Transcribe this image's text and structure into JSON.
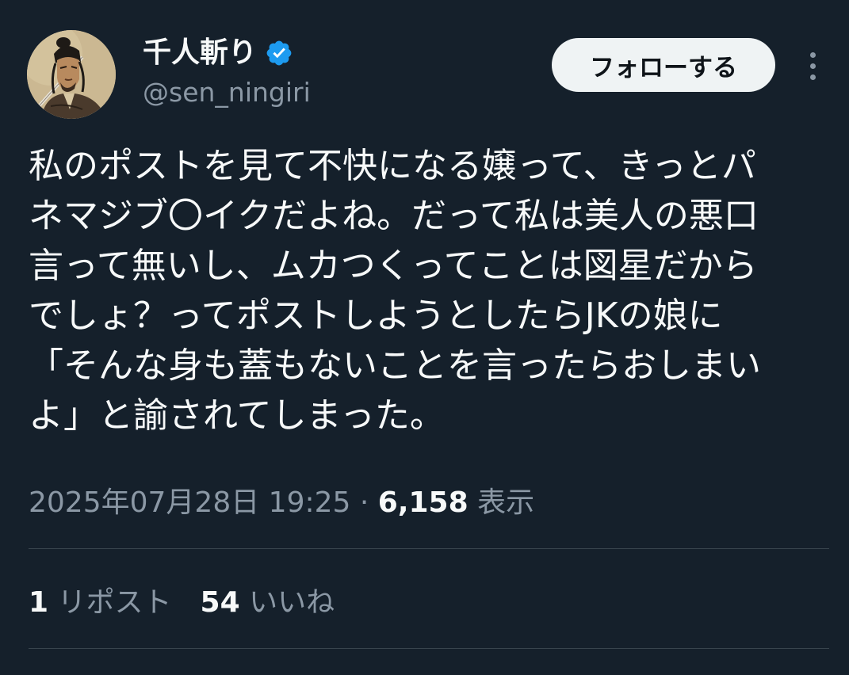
{
  "author": {
    "display_name": "千人斬り",
    "handle": "@sen_ningiri",
    "verified": true,
    "avatar_icon": "samurai-portrait"
  },
  "actions": {
    "follow_label": "フォローする",
    "more_icon": "more-vertical-icon"
  },
  "post": {
    "lines": [
      "私のポストを見て不快になる嬢って、きっとパ",
      "ネマジブ〇イクだよね。だって私は美人の悪口",
      "言って無いし、ムカつくってことは図星だから",
      "でしょ？ってポストしようとしたらJKの娘に",
      "「そんな身も蓋もないことを言ったらおしまい",
      "よ」と諭されてしまった。"
    ]
  },
  "meta": {
    "timestamp": "2025年07月28日 19:25",
    "separator": " · ",
    "views_count": "6,158",
    "views_label": " 表示"
  },
  "stats": {
    "reposts_count": "1",
    "reposts_label": " リポスト",
    "likes_count": "54",
    "likes_label": " いいね"
  },
  "colors": {
    "background": "#15202b",
    "text_primary": "#f7f9f9",
    "text_secondary": "#8b98a5",
    "verified_blue": "#1d9bf0",
    "divider": "#38444d",
    "follow_button_bg": "#eff3f4"
  }
}
